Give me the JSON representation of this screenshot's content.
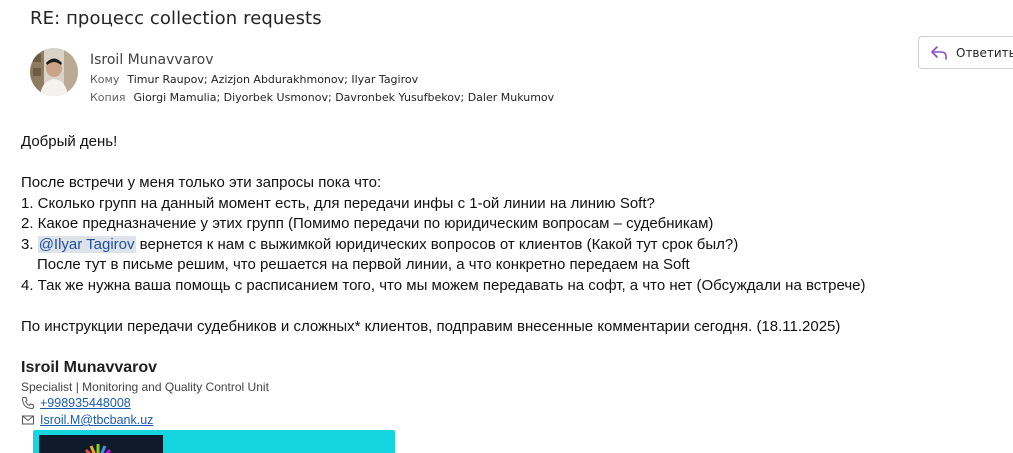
{
  "email": {
    "subject": "RE: процесс collection requests",
    "sender": "Isroil Munavvarov",
    "to_label": "Кому",
    "to": "Timur Raupov; Azizjon Abdurakhmonov; Ilyar Tagirov",
    "cc_label": "Копия",
    "cc": "Giorgi Mamulia; Diyorbek Usmonov; Davronbek Yusufbekov; Daler Mukumov",
    "reply_label": "Ответить"
  },
  "body": {
    "greeting": "Добрый день!",
    "intro": "После встречи у меня только эти запросы пока что:",
    "item1": "1. Сколько групп на данный момент есть, для передачи инфы с 1-ой линии на линию Soft?",
    "item2": "2. Какое предназначение у этих групп (Помимо передачи по юридическим вопросам – судебникам)",
    "item3_prefix": "3. ",
    "item3_mention": "@Ilyar Tagirov",
    "item3_rest": " вернется к нам с выжимкой юридических вопросов от клиентов (Какой тут срок был?)",
    "item3_cont": "После тут в письме решим, что решается на первой линии, а что конкретно передаем на Soft",
    "item4": "4. Так же нужна ваша помощь с расписанием того, что мы можем передавать на софт, а что нет (Обсуждали на встрече)",
    "closing": "По инструкции передачи судебников и сложных* клиентов, подправим внесенные комментарии сегодня. (18.11.2025)"
  },
  "signature": {
    "name": "Isroil Munavvarov",
    "title": "Specialist | Monitoring and Quality Control Unit",
    "phone": "+998935448008",
    "email": "Isroil.M@tbcbank.uz"
  },
  "colors": {
    "mention_bg": "#dde3ea",
    "link": "#1a5bb5",
    "reply_icon": "#8a4fd1",
    "banner": "#14d4e0"
  }
}
